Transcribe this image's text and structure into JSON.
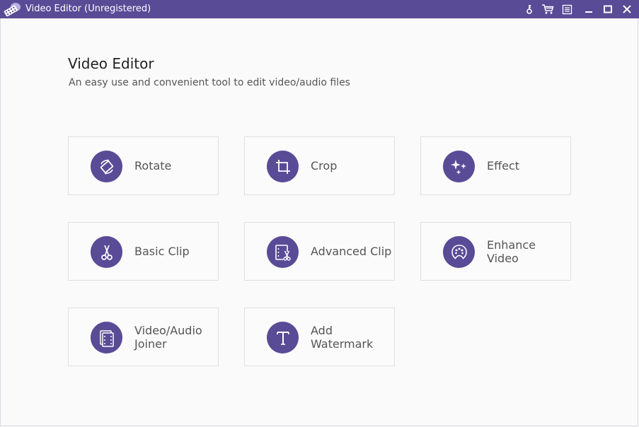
{
  "window": {
    "title": "Video Editor (Unregistered)",
    "controls": [
      "key-icon",
      "cart-icon",
      "menu-icon",
      "minimize-icon",
      "maximize-icon",
      "close-icon"
    ]
  },
  "header": {
    "title": "Video Editor",
    "subtitle": "An easy use and convenient tool to edit video/audio files"
  },
  "tools": [
    {
      "label": "Rotate",
      "icon": "rotate-icon"
    },
    {
      "label": "Crop",
      "icon": "crop-icon"
    },
    {
      "label": "Effect",
      "icon": "effect-icon"
    },
    {
      "label": "Basic Clip",
      "icon": "scissors-icon"
    },
    {
      "label": "Advanced Clip",
      "icon": "advanced-clip-icon"
    },
    {
      "label": "Enhance Video",
      "icon": "palette-icon"
    },
    {
      "label": "Video/Audio Joiner",
      "icon": "joiner-icon"
    },
    {
      "label": "Add Watermark",
      "icon": "text-icon"
    }
  ],
  "colors": {
    "accent": "#5a4b97",
    "background": "#fafafa",
    "card_border": "#e0e0e6"
  }
}
